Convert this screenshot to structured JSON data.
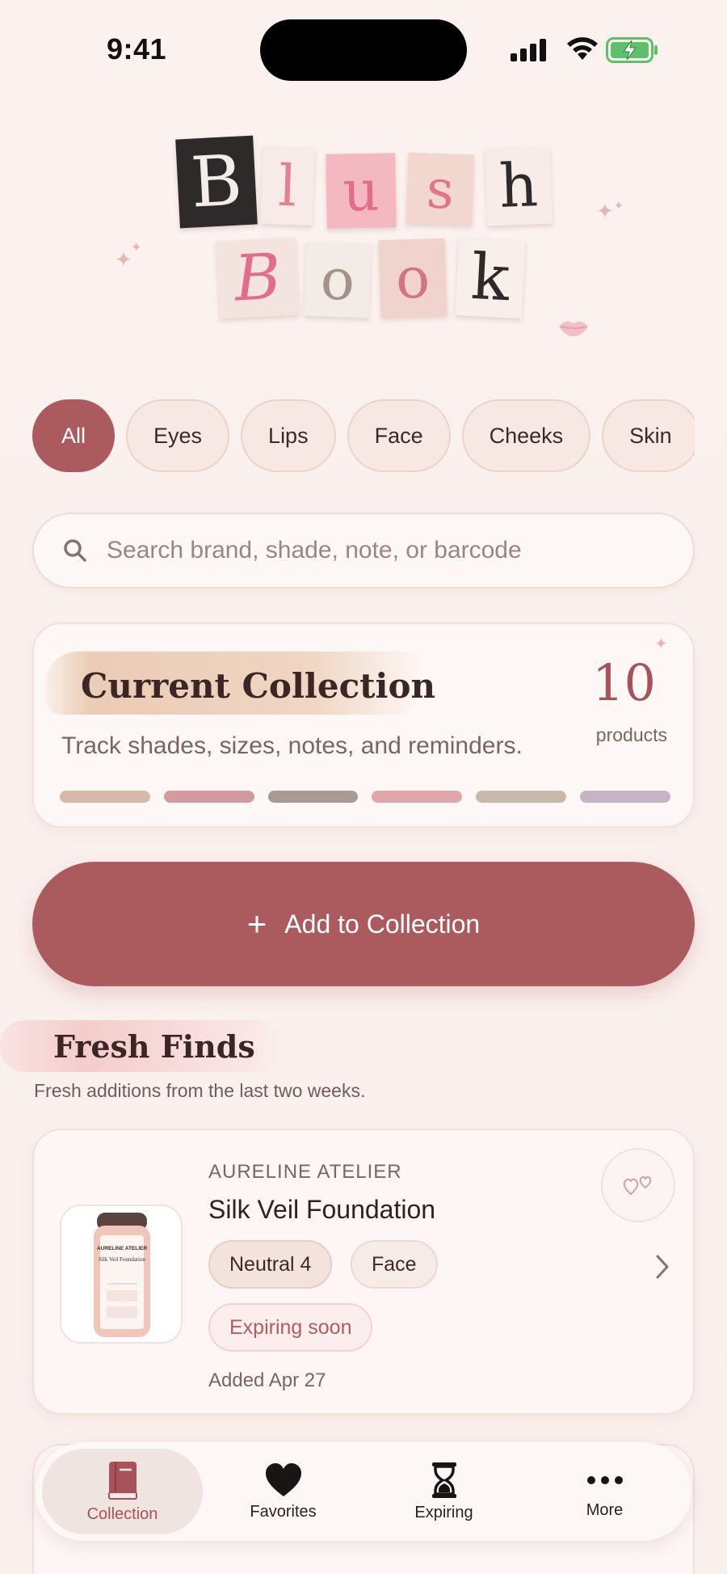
{
  "status": {
    "time": "9:41"
  },
  "logo": {
    "row1": [
      "B",
      "l",
      "u",
      "s",
      "h"
    ],
    "row2": [
      "B",
      "o",
      "o",
      "k"
    ]
  },
  "chips": [
    {
      "label": "All",
      "active": true
    },
    {
      "label": "Eyes",
      "active": false
    },
    {
      "label": "Lips",
      "active": false
    },
    {
      "label": "Face",
      "active": false
    },
    {
      "label": "Cheeks",
      "active": false
    },
    {
      "label": "Skin",
      "active": false
    }
  ],
  "search": {
    "placeholder": "Search brand, shade, note, or barcode"
  },
  "collection": {
    "title": "Current Collection",
    "subtitle": "Track shades, sizes, notes, and reminders.",
    "count": "10",
    "unit": "products",
    "swatch_colors": [
      "#d7b9a7",
      "#d39a9f",
      "#a99a95",
      "#e0a7ab",
      "#c9b9a8",
      "#c5b5c4"
    ]
  },
  "add_button": {
    "label": "Add to Collection"
  },
  "fresh_finds": {
    "title": "Fresh Finds",
    "subtitle": "Fresh additions from the last two weeks."
  },
  "product": {
    "brand": "AURELINE ATELIER",
    "name": "Silk Veil Foundation",
    "tags": [
      "Neutral 4",
      "Face"
    ],
    "status": "Expiring soon",
    "added": "Added Apr 27",
    "bottle_brand": "AURELINE ATELIER",
    "bottle_name": "Silk Veil Foundation"
  },
  "tabs": [
    {
      "label": "Collection",
      "icon": "book-icon",
      "active": true
    },
    {
      "label": "Favorites",
      "icon": "heart-icon",
      "active": false
    },
    {
      "label": "Expiring",
      "icon": "hourglass-icon",
      "active": false
    },
    {
      "label": "More",
      "icon": "more-icon",
      "active": false
    }
  ],
  "colors": {
    "accent": "#ab5a5e",
    "background": "#fbf1ee",
    "card": "#fdf8f6"
  }
}
